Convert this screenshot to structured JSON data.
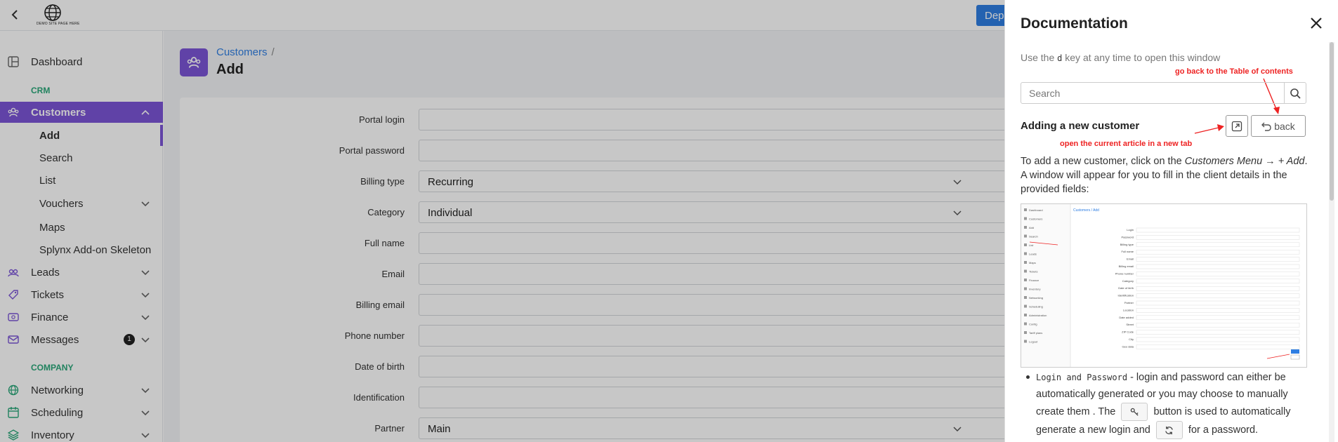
{
  "topbar": {
    "logo_text": "DEMO SITE PAGE HERE",
    "deploy_label": "Deploy"
  },
  "sidebar": {
    "items": [
      {
        "key": "dashboard",
        "label": "Dashboard",
        "icon": "dashboard-icon"
      },
      {
        "key": "crm-section",
        "label": "CRM"
      },
      {
        "key": "customers",
        "label": "Customers",
        "icon": "customers-icon",
        "active": true
      },
      {
        "key": "add",
        "label": "Add"
      },
      {
        "key": "search",
        "label": "Search"
      },
      {
        "key": "list",
        "label": "List"
      },
      {
        "key": "vouchers",
        "label": "Vouchers"
      },
      {
        "key": "maps",
        "label": "Maps"
      },
      {
        "key": "splynx",
        "label": "Splynx Add-on Skeleton"
      },
      {
        "key": "leads",
        "label": "Leads",
        "icon": "leads-icon"
      },
      {
        "key": "tickets",
        "label": "Tickets",
        "icon": "tickets-icon"
      },
      {
        "key": "finance",
        "label": "Finance",
        "icon": "finance-icon"
      },
      {
        "key": "messages",
        "label": "Messages",
        "icon": "messages-icon",
        "badge": "1"
      },
      {
        "key": "company-section",
        "label": "COMPANY"
      },
      {
        "key": "networking",
        "label": "Networking",
        "icon": "networking-icon"
      },
      {
        "key": "scheduling",
        "label": "Scheduling",
        "icon": "scheduling-icon"
      },
      {
        "key": "inventory",
        "label": "Inventory",
        "icon": "inventory-icon"
      }
    ]
  },
  "main": {
    "breadcrumb_link": "Customers",
    "breadcrumb_sep": "/",
    "title": "Add",
    "form": [
      {
        "label": "Portal login",
        "value": ""
      },
      {
        "label": "Portal password",
        "value": ""
      },
      {
        "label": "Billing type",
        "value": "Recurring"
      },
      {
        "label": "Category",
        "value": "Individual"
      },
      {
        "label": "Full name",
        "value": ""
      },
      {
        "label": "Email",
        "value": ""
      },
      {
        "label": "Billing email",
        "value": ""
      },
      {
        "label": "Phone number",
        "value": ""
      },
      {
        "label": "Date of birth",
        "value": ""
      },
      {
        "label": "Identification",
        "value": ""
      },
      {
        "label": "Partner",
        "value": "Main"
      }
    ]
  },
  "doc": {
    "title": "Documentation",
    "hint_before": "Use the",
    "hint_key": "d",
    "hint_after": "key at any time to open this window",
    "search_placeholder": "Search",
    "annotation_back": "go back to the Table of contents",
    "annotation_newtab": "open the current article in a new tab",
    "article_title": "Adding a new customer",
    "back_label": "back",
    "para_a": "To add a new customer, click on the",
    "para_em": "Customers Menu → + Add",
    "para_b": ". A window will appear for you to fill in the client details in the provided fields:",
    "bullet_code": "Login and Password",
    "bullet_a": "- login and password can either be automatically generated or you may choose to manually create them . The",
    "bullet_b": "button is used to automatically generate a new login and",
    "bullet_c": "for a password.",
    "thumb": {
      "crumb": "Customers / Add",
      "labels": [
        "Login",
        "Password",
        "Billing type",
        "Full name",
        "Email",
        "Billing email",
        "Phone number",
        "Category",
        "Date of birth",
        "Identification",
        "Partner",
        "Location",
        "Date added",
        "Street",
        "ZIP Code",
        "City",
        "Geo data"
      ],
      "menu": [
        "Dashboard",
        "Customers",
        "Add",
        "Search",
        "List",
        "Leads",
        "Maps",
        "Tickets",
        "Finance",
        "Inventory",
        "Networking",
        "Scheduling",
        "Administration",
        "Config",
        "Tariff plans",
        "Logout"
      ]
    }
  },
  "colors": {
    "accent": "#7b55d6",
    "link": "#2f7ee2",
    "section": "#2aa779",
    "annotation": "#e22222"
  }
}
